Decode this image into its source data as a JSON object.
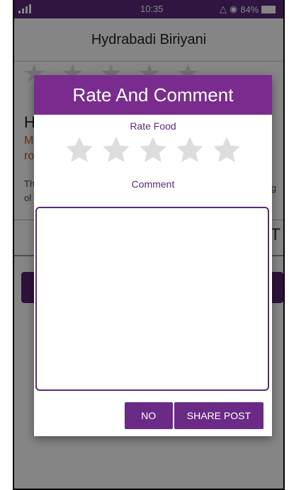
{
  "status_bar": {
    "time": "10:35",
    "battery": "84%"
  },
  "app_header": {
    "title": "Hydrabadi Biriyani"
  },
  "background": {
    "heading_fragment": "H",
    "line1_fragment": "M",
    "line2_fragment": "ro",
    "desc1_fragment": "Th",
    "desc2_fragment": "ol",
    "desc_right_fragment": "g",
    "right_fragment": "T"
  },
  "dialog": {
    "title": "Rate And Comment",
    "rate_label": "Rate Food",
    "rating": 0,
    "max_rating": 5,
    "comment_label": "Comment",
    "comment_value": "",
    "no_button": "NO",
    "share_button": "SHARE POST"
  },
  "colors": {
    "accent": "#7a2c8e",
    "status_bar": "#5b2a7a",
    "star_empty": "#dddddd"
  }
}
